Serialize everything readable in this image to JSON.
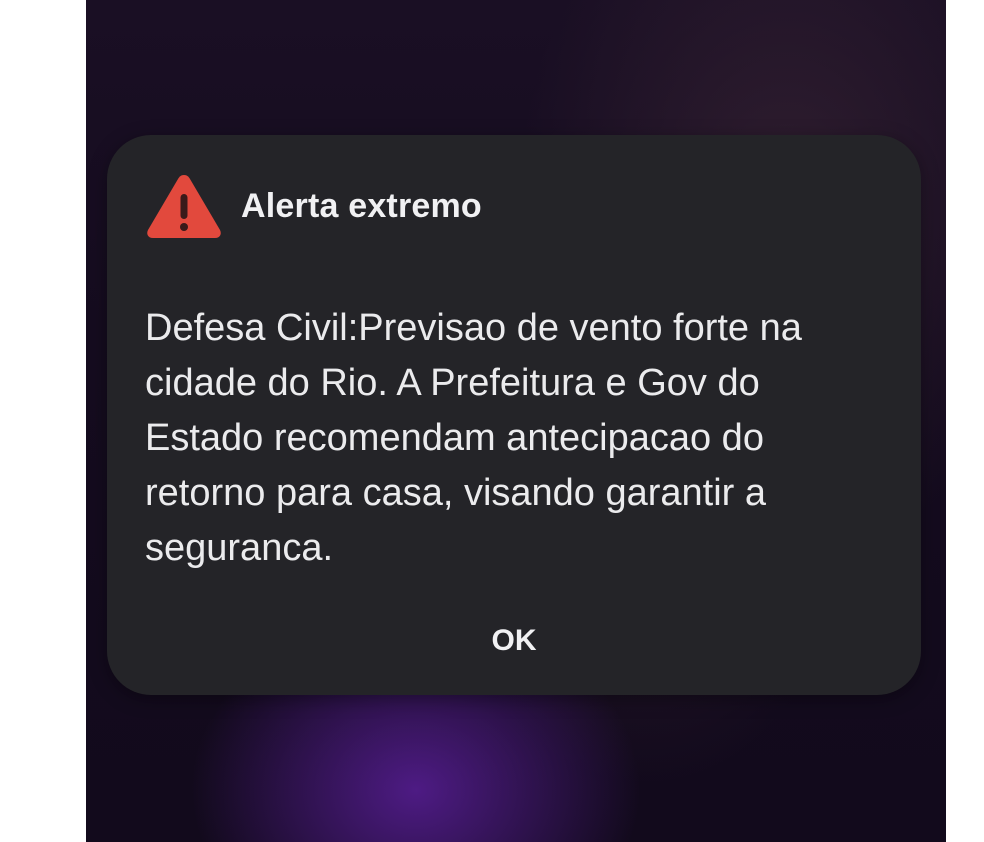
{
  "alert": {
    "icon": "warning-triangle-icon",
    "icon_color": "#e2493d",
    "title": "Alerta extremo",
    "message": "Defesa Civil:Previsao de vento forte na\ncidade do Rio. A Prefeitura e Gov do\nEstado recomendam antecipacao do\nretorno para casa, visando garantir a\nseguranca.",
    "ok_label": "OK"
  },
  "colors": {
    "dialog_background": "#242428",
    "text": "#ebebed"
  }
}
